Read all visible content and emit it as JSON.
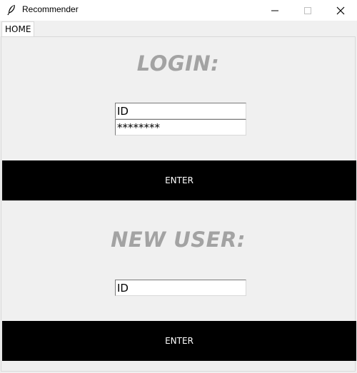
{
  "window": {
    "title": "Recommender",
    "app_icon": "feather-icon",
    "controls": [
      "minimize-icon",
      "maximize-icon",
      "close-icon"
    ]
  },
  "tabs": [
    {
      "label": "HOME",
      "selected": true
    }
  ],
  "login": {
    "heading": "LOGIN:",
    "id_value": "ID",
    "password_value": "********",
    "button_label": "ENTER"
  },
  "new_user": {
    "heading": "NEW USER:",
    "id_value": "ID",
    "button_label": "ENTER"
  },
  "colors": {
    "heading": "#a3a3a3",
    "button_bg": "#000000",
    "button_text": "#ffffff",
    "background": "#f0f0f0"
  }
}
